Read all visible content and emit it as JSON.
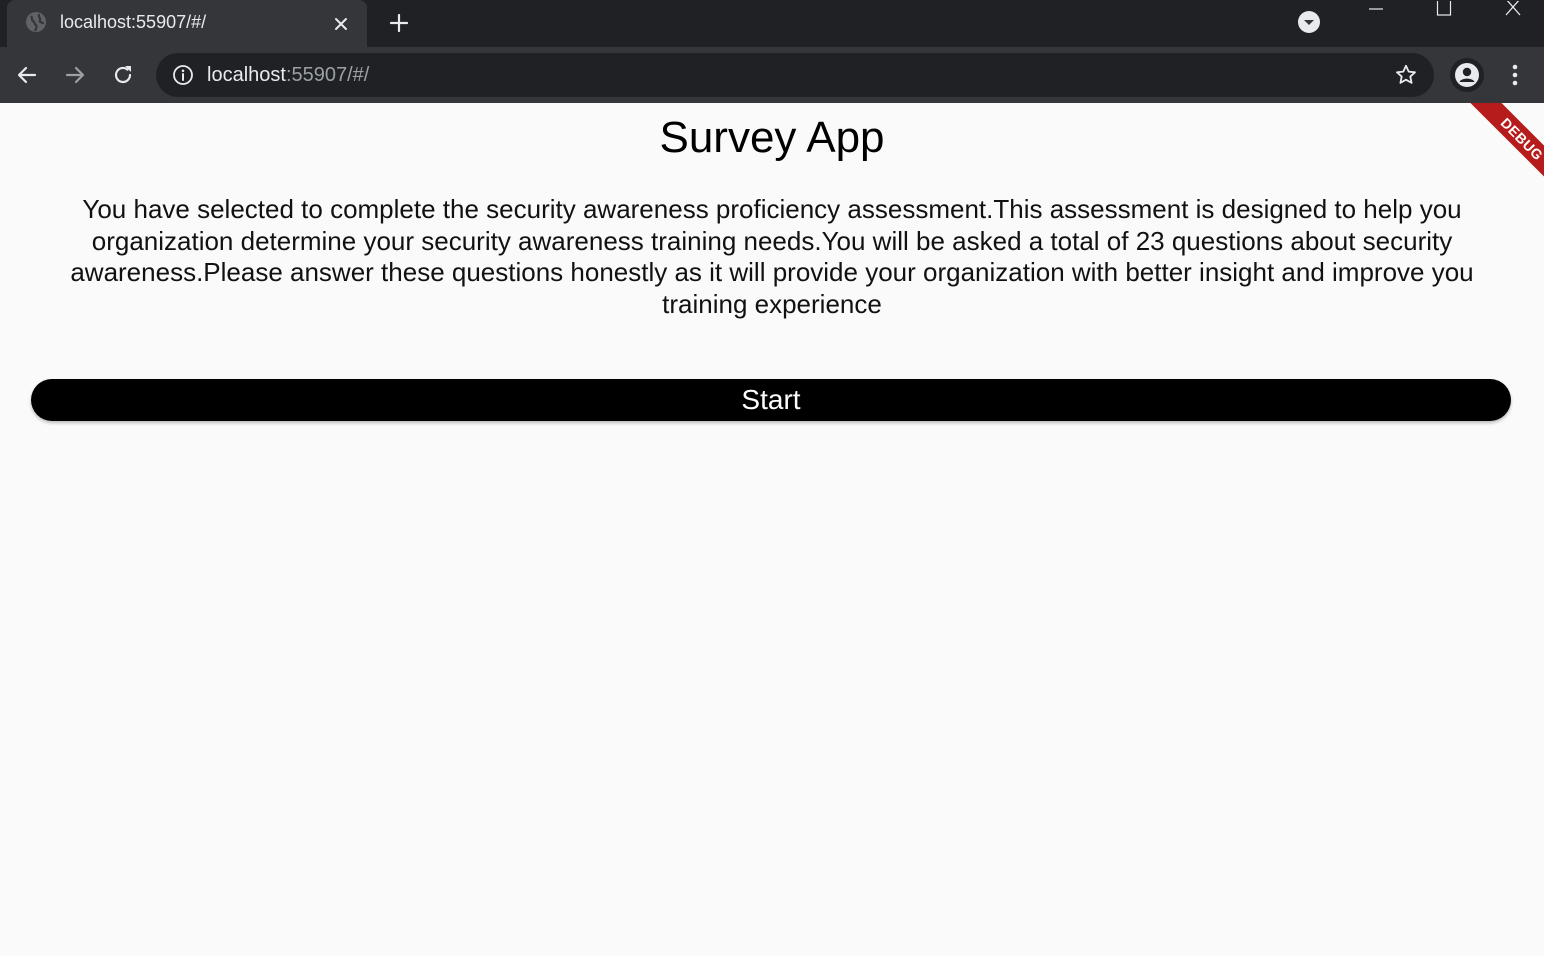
{
  "browser": {
    "tab_title": "localhost:55907/#/",
    "url_host": "localhost",
    "url_rest": ":55907/#/",
    "icons": {
      "favicon": "globe-icon",
      "close": "close-icon",
      "new_tab": "plus-icon",
      "tab_search": "chevron-down-icon",
      "minimize": "minimize-icon",
      "maximize": "maximize-icon",
      "window_close": "close-icon",
      "back": "arrow-left-icon",
      "forward": "arrow-right-icon",
      "reload": "reload-icon",
      "site_info": "info-icon",
      "bookmark": "star-icon",
      "profile": "person-icon",
      "menu": "kebab-menu-icon"
    },
    "colors": {
      "tabstrip": "#202124",
      "toolbar": "#35363a",
      "omnibox": "#202124"
    }
  },
  "app": {
    "title": "Survey App",
    "intro": "You have selected to complete the security awareness proficiency assessment.This assessment is designed to help you organization determine your security awareness training needs.You will be asked a total of 23 questions  about security awareness.Please answer these questions honestly as it will provide your organization with better insight and improve you training experience",
    "start_label": "Start",
    "debug_label": "DEBUG",
    "colors": {
      "background": "#fafafa",
      "button": "#000000",
      "button_text": "#ffffff",
      "debug_banner": "#b71c1c"
    }
  }
}
